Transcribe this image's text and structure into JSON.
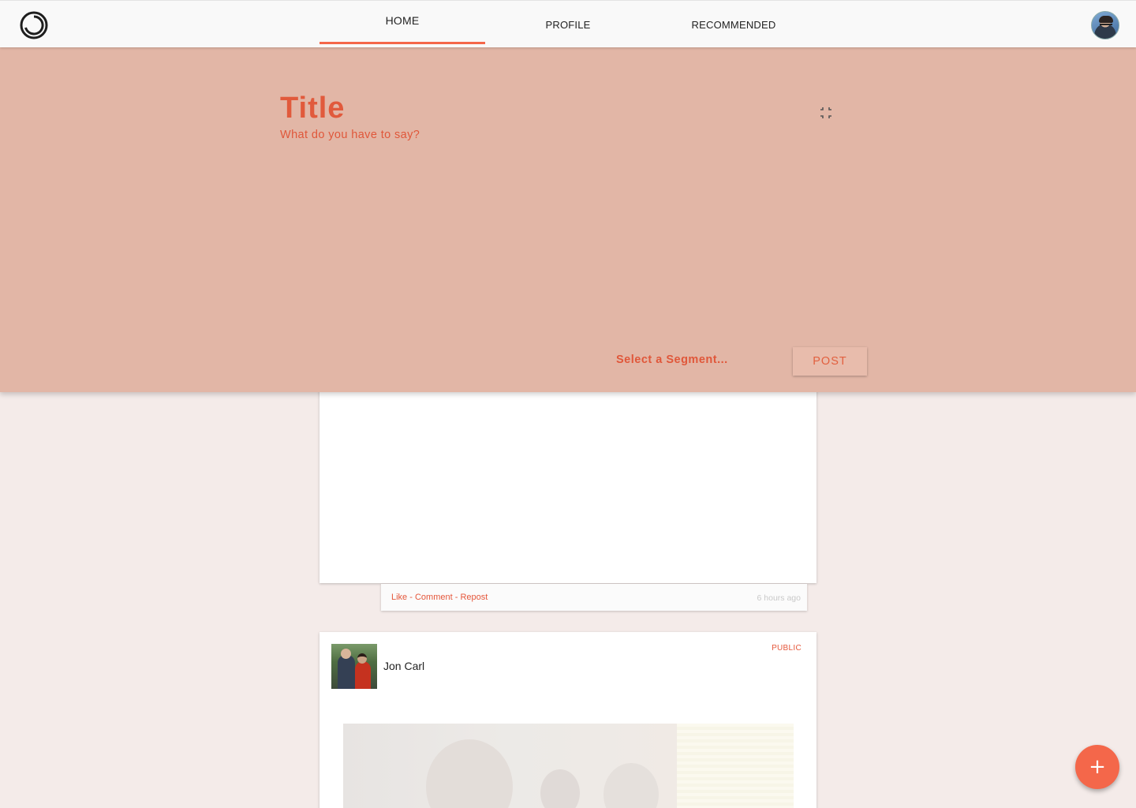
{
  "nav": {
    "tabs": [
      {
        "label": "HOME",
        "active": true
      },
      {
        "label": "PROFILE",
        "active": false
      },
      {
        "label": "RECOMMENDED",
        "active": false
      }
    ],
    "logo_icon": "ring-logo-icon",
    "avatar_icon": "user-avatar"
  },
  "compose": {
    "title_placeholder": "Title",
    "body_placeholder": "What do you have to say?",
    "collapse_icon": "collapse-icon",
    "segment_select": "Select a Segment...",
    "post_label": "POST"
  },
  "feed": {
    "post1": {
      "actions": {
        "like": "Like",
        "comment": "Comment",
        "repost": "Repost",
        "separator": " - "
      },
      "timestamp": "6 hours ago"
    },
    "post2": {
      "author": "Jon Carl",
      "visibility": "PUBLIC"
    }
  },
  "fab": {
    "label": "+",
    "icon": "plus-icon"
  },
  "colors": {
    "accent": "#f4674a",
    "compose_bg": "#e2b6a6",
    "page_bg": "#f4ebe9",
    "accent_text": "#e15a3c"
  }
}
